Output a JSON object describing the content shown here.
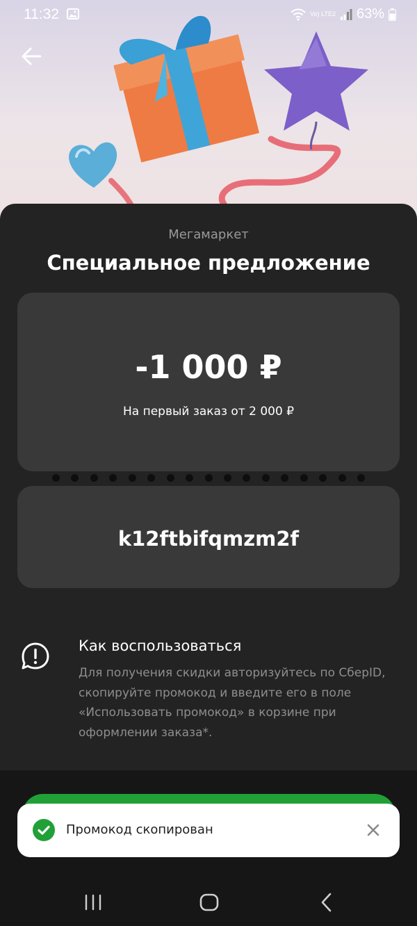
{
  "status_bar": {
    "time": "11:32",
    "network": "Vo) LTE2",
    "battery": "63%",
    "icons": [
      "gallery-icon",
      "wifi-icon",
      "signal-icon",
      "battery-icon"
    ]
  },
  "header": {
    "back_icon": "arrow-left-icon"
  },
  "offer": {
    "provider": "Мегамаркет",
    "title": "Специальное предложение",
    "amount": "-1 000 ₽",
    "condition": "На первый заказ от 2 000 ₽",
    "promo_code": "k12ftbifqmzm2f"
  },
  "howto": {
    "icon": "alert-message-icon",
    "title": "Как воспользоваться",
    "text": "Для получения скидки авторизуйтесь по СберID, скопируйте промокод и введите его в поле «Использовать промокод» в корзине при оформлении заказа*."
  },
  "toast": {
    "icon": "check-circle-icon",
    "message": "Промокод скопирован",
    "close_icon": "close-icon"
  },
  "nav": {
    "items": [
      "recent-apps-icon",
      "home-icon",
      "back-icon"
    ]
  },
  "colors": {
    "accent_green": "#21a038",
    "sheet_bg": "#232323",
    "card_bg": "#393939"
  }
}
